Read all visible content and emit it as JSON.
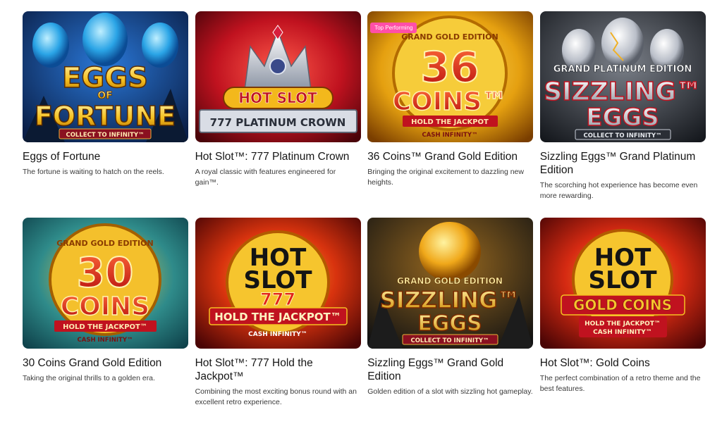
{
  "games": [
    {
      "title": "Eggs of Fortune",
      "description": "The fortune is waiting to hatch on the reels.",
      "logo_lines": [
        "EGGS",
        "OF",
        "FORTUNE"
      ],
      "ribbon": "COLLECT TO INFINITY™",
      "colors": {
        "bg1": "#0d2f6a",
        "bg2": "#1d5fb8",
        "text": "#f7c325"
      }
    },
    {
      "title": "Hot Slot™: 777 Platinum Crown",
      "description": "A royal classic with features engineered for gain™.",
      "logo_lines": [
        "HOT SLOT",
        "777 PLATINUM CROWN"
      ],
      "colors": {
        "bg1": "#6d0710",
        "bg2": "#e0202f",
        "text": "#f5d033"
      }
    },
    {
      "title": "36 Coins™ Grand Gold Edition",
      "description": "Bringing the original excitement to dazzling new heights.",
      "badge": "Top Performing",
      "logo_lines": [
        "GRAND GOLD EDITION",
        "36",
        "COINS™",
        "HOLD THE JACKPOT",
        "CASH INFINITY™"
      ],
      "colors": {
        "bg1": "#a65a00",
        "bg2": "#f3c01e",
        "text": "#e01d1d"
      }
    },
    {
      "title": "Sizzling Eggs™ Grand Platinum Edition",
      "description": "The scorching hot experience has become even more rewarding.",
      "logo_lines": [
        "GRAND PLATINUM EDITION",
        "SIZZLING™",
        "EGGS",
        "COLLECT TO INFINITY™"
      ],
      "colors": {
        "bg1": "#1e2229",
        "bg2": "#5a5f69",
        "text": "#d9dde3"
      }
    },
    {
      "title": "30 Coins Grand Gold Edition",
      "description": "Taking the original thrills to a golden era.",
      "logo_lines": [
        "GRAND GOLD EDITION",
        "30",
        "COINS",
        "HOLD THE JACKPOT™",
        "CASH INFINITY™"
      ],
      "colors": {
        "bg1": "#0f5060",
        "bg2": "#d9a320",
        "text": "#e2231a"
      }
    },
    {
      "title": "Hot Slot™: 777 Hold the Jackpot™",
      "description": "Combining the most exciting bonus round with an excellent retro experience.",
      "logo_lines": [
        "HOT",
        "SLOT",
        "777",
        "HOLD THE JACKPOT™",
        "CASH INFINITY™"
      ],
      "colors": {
        "bg1": "#5a0707",
        "bg2": "#e84a10",
        "text": "#1a1a1a"
      }
    },
    {
      "title": "Sizzling Eggs™ Grand Gold Edition",
      "description": "Golden edition of a slot with sizzling hot gameplay.",
      "logo_lines": [
        "GRAND GOLD EDITION",
        "SIZZLING™",
        "EGGS",
        "COLLECT TO INFINITY™"
      ],
      "colors": {
        "bg1": "#1c1a1a",
        "bg2": "#6a4314",
        "text": "#f6c833"
      }
    },
    {
      "title": "Hot Slot™: Gold Coins",
      "description": "The perfect combination of a retro theme and the best features.",
      "logo_lines": [
        "HOT",
        "SLOT",
        "GOLD COINS",
        "HOLD THE JACKPOT™",
        "CASH INFINITY™"
      ],
      "colors": {
        "bg1": "#6c0707",
        "bg2": "#e2361a",
        "text": "#1a1a1a"
      }
    }
  ]
}
